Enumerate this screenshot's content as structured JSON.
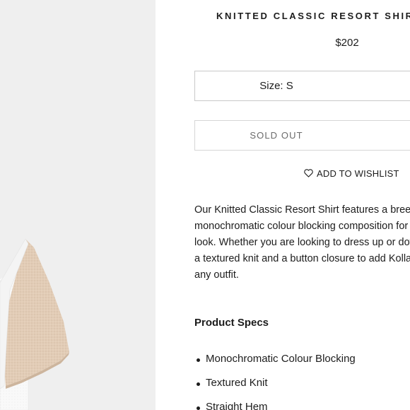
{
  "product": {
    "title": "KNITTED CLASSIC RESORT SHIRT -",
    "price": "$202",
    "size_selector": "Size: S",
    "availability_button": "SOLD OUT",
    "wishlist_label": "ADD TO WISHLIST",
    "image_alt": "Knitted Classic Resort Shirt sleeve detail"
  },
  "description": {
    "lines": [
      "Our Knitted Classic Resort Shirt features a breez",
      "monochromatic colour blocking composition for a",
      "look. Whether you are looking to dress up or dow",
      "a textured knit and a button closure to add Kollar'",
      "any outfit."
    ]
  },
  "specs": {
    "heading": "Product Specs",
    "items": [
      "Monochromatic Colour Blocking",
      "Textured Knit",
      "Straight Hem"
    ]
  },
  "colors": {
    "image_background": "#efefef",
    "sleeve_beige": "#e2ccb6",
    "shirt_white": "#fafafa",
    "border": "#c9c9c9",
    "text": "#1c1c1c",
    "muted_text": "#6b6b6b"
  }
}
